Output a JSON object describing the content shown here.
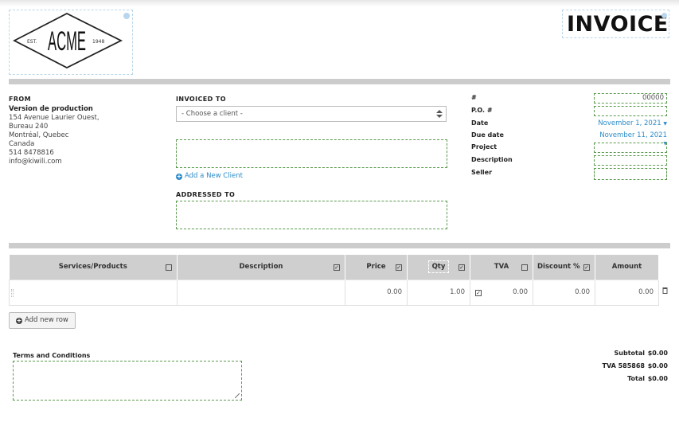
{
  "logo": {
    "brand": "ACME",
    "left_text": "EST.",
    "right_text": "1948"
  },
  "header": {
    "title": "INVOICE"
  },
  "from": {
    "label": "FROM",
    "company": "Version de production",
    "lines": [
      "154 Avenue Laurier Ouest,",
      "Bureau 240",
      "Montréal, Quebec",
      "Canada",
      "514 8478816",
      "info@kiwili.com"
    ]
  },
  "invoiced_to": {
    "label": "INVOICED TO",
    "select_value": "- Choose a client -",
    "add_client_label": "Add a New Client"
  },
  "addressed_to": {
    "label": "ADDRESSED TO"
  },
  "meta": {
    "number_label": "#",
    "number_value": "00000",
    "po_label": "P.O. #",
    "date_label": "Date",
    "date_value": "November 1, 2021",
    "due_label": "Due date",
    "due_value": "November 11, 2021",
    "project_label": "Project",
    "description_label": "Description",
    "seller_label": "Seller",
    "accent_color": "#2c8bc9"
  },
  "table": {
    "columns": [
      {
        "label": "Services/Products",
        "checked": false
      },
      {
        "label": "Description",
        "checked": true
      },
      {
        "label": "Price",
        "checked": true
      },
      {
        "label": "Qty",
        "checked": true
      },
      {
        "label": "TVA",
        "checked": false
      },
      {
        "label": "Discount %",
        "checked": true
      },
      {
        "label": "Amount"
      }
    ],
    "rows": [
      {
        "service": "",
        "description": "",
        "price": "0.00",
        "qty": "1.00",
        "tva_checked": true,
        "tva": "0.00",
        "discount": "0.00",
        "amount": "0.00"
      }
    ],
    "add_row_label": "Add new row"
  },
  "terms": {
    "label": "Terms and Conditions"
  },
  "totals": {
    "subtotal_label": "Subtotal",
    "subtotal_value": "$0.00",
    "tax_label": "TVA 585868",
    "tax_value": "$0.00",
    "total_label": "Total",
    "total_value": "$0.00"
  }
}
